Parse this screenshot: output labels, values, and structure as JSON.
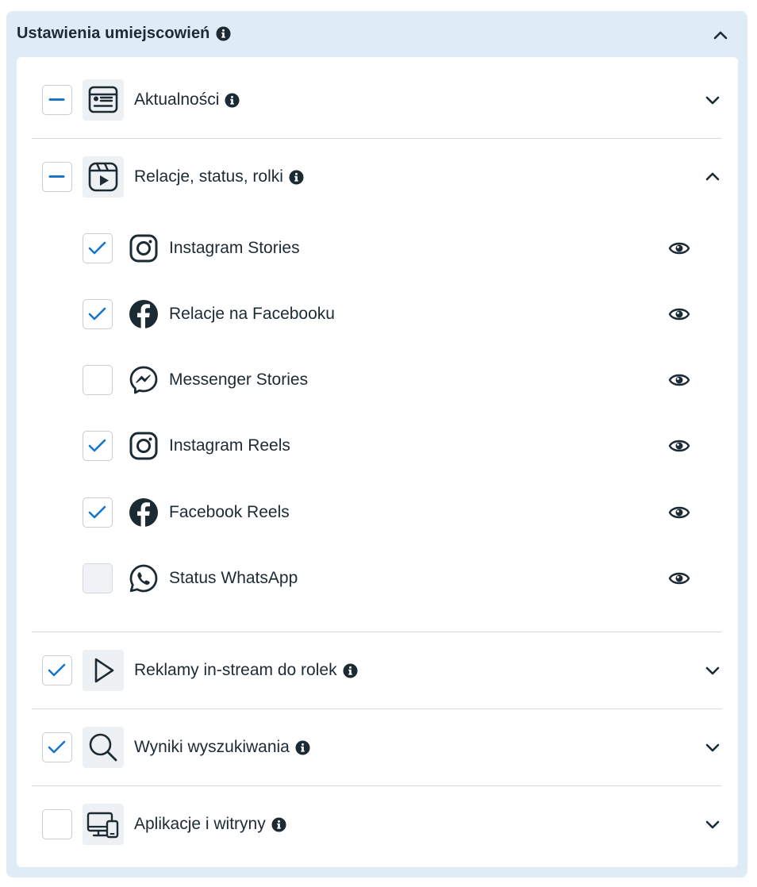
{
  "panel": {
    "title": "Ustawienia umiejscowień",
    "title_icon": "info-icon",
    "collapse_icon": "chevron-up-icon"
  },
  "sections": [
    {
      "label": "Aktualności",
      "icon": "feed-icon",
      "checkbox": "indeterminate",
      "info": true,
      "expanded": false
    },
    {
      "label": "Relacje, status, rolki",
      "icon": "stories-reels-icon",
      "checkbox": "indeterminate",
      "info": true,
      "expanded": true,
      "items": [
        {
          "label": "Instagram Stories",
          "icon": "instagram-icon",
          "checked": true
        },
        {
          "label": "Relacje na Facebooku",
          "icon": "facebook-icon",
          "checked": true
        },
        {
          "label": "Messenger Stories",
          "icon": "messenger-icon",
          "checked": false
        },
        {
          "label": "Instagram Reels",
          "icon": "instagram-icon",
          "checked": true
        },
        {
          "label": "Facebook Reels",
          "icon": "facebook-icon",
          "checked": true
        },
        {
          "label": "Status WhatsApp",
          "icon": "whatsapp-icon",
          "checked": false,
          "disabled": true
        }
      ]
    },
    {
      "label": "Reklamy in-stream do rolek",
      "icon": "play-icon",
      "checkbox": "checked",
      "info": true,
      "expanded": false
    },
    {
      "label": "Wyniki wyszukiwania",
      "icon": "search-icon",
      "checkbox": "checked",
      "info": true,
      "expanded": false
    },
    {
      "label": "Aplikacje i witryny",
      "icon": "devices-icon",
      "checkbox": "unchecked",
      "info": true,
      "expanded": false
    }
  ],
  "colors": {
    "panel_bg": "#dfecf6",
    "accent": "#1877c9",
    "text": "#1c2b33",
    "divider": "#d5d9dd"
  }
}
